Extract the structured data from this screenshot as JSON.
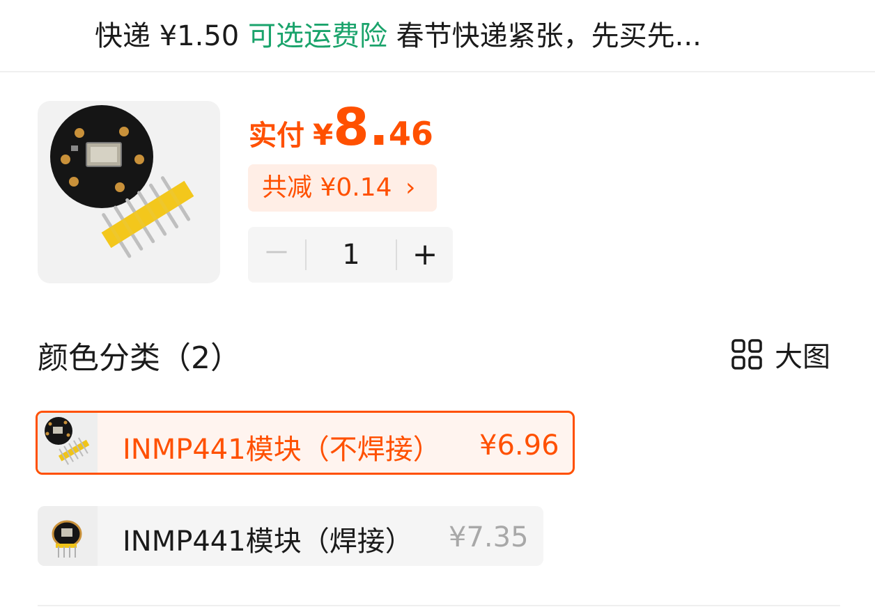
{
  "shipping": {
    "prefix": "快递 ¥1.50 ",
    "insurance_link": "可选运费险",
    "notice": " 春节快递紧张，先买先..."
  },
  "product": {
    "image_icon": "inmp441-module-photo",
    "pay_label": "实付",
    "pay_currency": "¥",
    "pay_integer": "8.",
    "pay_decimal": "46",
    "discount_label": "共减 ¥0.14",
    "discount_chevron": "›",
    "quantity": {
      "minus": "－",
      "value": "1",
      "plus": "+"
    }
  },
  "variants": {
    "title": "颜色分类（2）",
    "view_toggle_icon": "grid-icon",
    "view_toggle_label": "大图",
    "options": [
      {
        "name": "INMP441模块（不焊接）",
        "price": "¥6.96",
        "selected": true
      },
      {
        "name": "INMP441模块（焊接）",
        "price": "¥7.35",
        "selected": false
      }
    ]
  },
  "colors": {
    "accent": "#ff5000",
    "accent_bg": "#ffeee6",
    "link_green": "#1aa36b",
    "muted": "#a8a8a8"
  }
}
